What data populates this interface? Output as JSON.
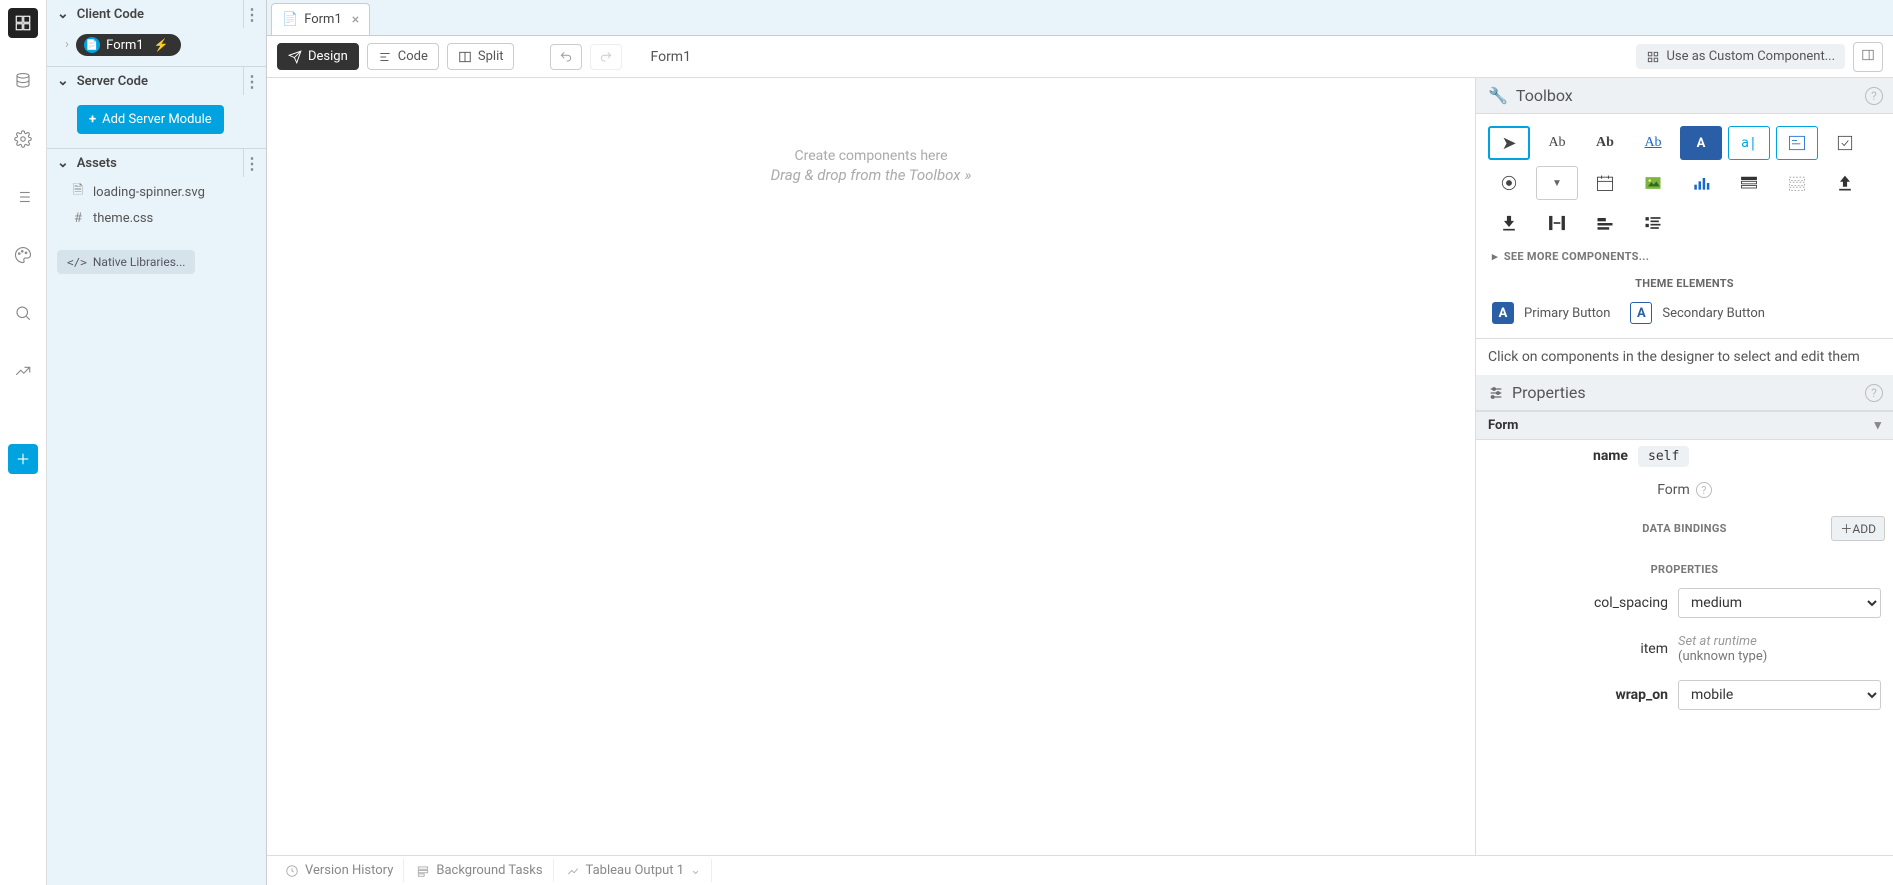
{
  "sidebar": {
    "client_code": "Client Code",
    "server_code": "Server Code",
    "assets": "Assets",
    "form_name": "Form1",
    "add_server_module": "Add Server Module",
    "asset_items": [
      "loading-spinner.svg",
      "theme.css"
    ],
    "native_libraries": "Native Libraries..."
  },
  "tab": {
    "label": "Form1"
  },
  "toolbar": {
    "design": "Design",
    "code": "Code",
    "split": "Split",
    "breadcrumb": "Form1",
    "custom_component": "Use as Custom Component..."
  },
  "canvas": {
    "hint1": "Create components here",
    "hint2": "Drag & drop from the Toolbox"
  },
  "toolbox": {
    "title": "Toolbox",
    "see_more": "SEE MORE COMPONENTS...",
    "theme_head": "THEME ELEMENTS",
    "primary_button": "Primary Button",
    "secondary_button": "Secondary Button",
    "hint": "Click on components in the designer to select and edit them"
  },
  "properties": {
    "title": "Properties",
    "section_label": "Form",
    "name_label": "name",
    "name_value": "self",
    "form_text": "Form",
    "data_bindings": "DATA BINDINGS",
    "add": "ADD",
    "properties_head": "PROPERTIES",
    "col_spacing_label": "col_spacing",
    "col_spacing_value": "medium",
    "item_label": "item",
    "item_hint1": "Set at runtime",
    "item_hint2": "(unknown type)",
    "wrap_on_label": "wrap_on",
    "wrap_on_value": "mobile"
  },
  "statusbar": {
    "version_history": "Version History",
    "background_tasks": "Background Tasks",
    "tableau": "Tableau Output 1"
  }
}
